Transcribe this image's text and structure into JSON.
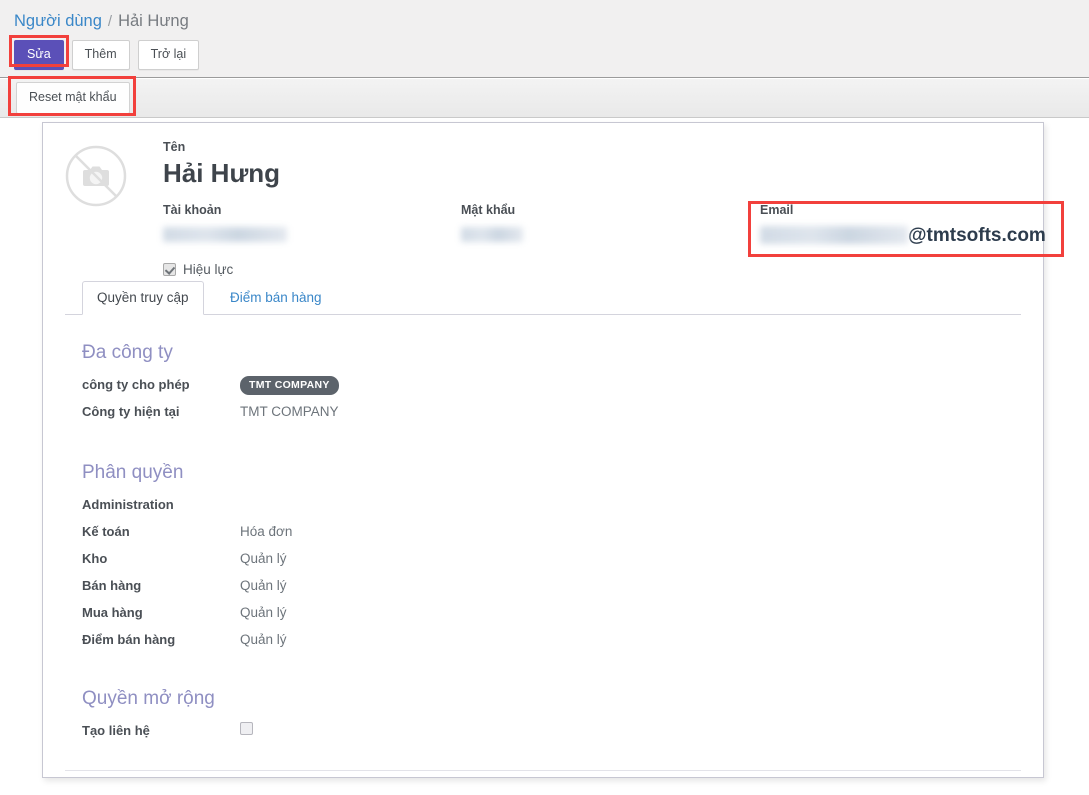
{
  "breadcrumb": {
    "parent": "Người dùng",
    "separator": "/",
    "current": "Hải Hưng"
  },
  "toolbar": {
    "edit_label": "Sửa",
    "add_label": "Thêm",
    "back_label": "Trở lại",
    "reset_password_label": "Reset mật khẩu"
  },
  "colors": {
    "primary_button": "#5b50b8",
    "link": "#3a87c8",
    "section_heading": "#8f8fc2",
    "pill_background": "#5c636b",
    "annotation": "#f2403c"
  },
  "user": {
    "avatar_icon": "no-camera-icon",
    "name_label": "Tên",
    "name_value": "Hải Hưng",
    "account_label": "Tài khoản",
    "account_value": "",
    "password_label": "Mật khẩu",
    "password_value": "",
    "email_label": "Email",
    "email_local_part": "",
    "email_domain": "@tmtsofts.com",
    "active_label": "Hiệu lực",
    "active_checked": true
  },
  "tabs": [
    {
      "label": "Quyền truy cập",
      "active": true
    },
    {
      "label": "Điểm bán hàng",
      "active": false
    }
  ],
  "sections": {
    "multicompany": {
      "title": "Đa công ty",
      "allowed_label": "công ty cho phép",
      "allowed_value": "TMT COMPANY",
      "current_label": "Công ty hiện tại",
      "current_value": "TMT COMPANY"
    },
    "permissions": {
      "title": "Phân quyền",
      "rows": [
        {
          "label": "Administration",
          "value": ""
        },
        {
          "label": "Kế toán",
          "value": "Hóa đơn"
        },
        {
          "label": "Kho",
          "value": "Quản lý"
        },
        {
          "label": "Bán hàng",
          "value": "Quản lý"
        },
        {
          "label": "Mua hàng",
          "value": "Quản lý"
        },
        {
          "label": "Điểm bán hàng",
          "value": "Quản lý"
        }
      ]
    },
    "extended": {
      "title": "Quyền mở rộng",
      "create_contact_label": "Tạo liên hệ",
      "create_contact_checked": false
    }
  }
}
